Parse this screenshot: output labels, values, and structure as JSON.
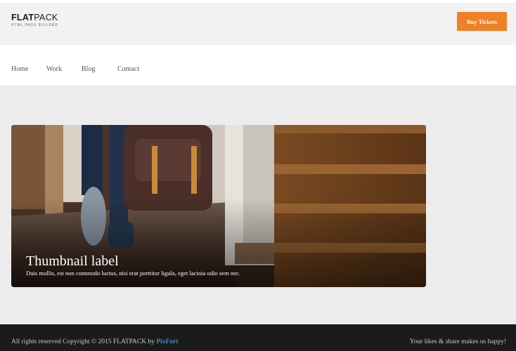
{
  "header": {
    "logo": {
      "title_bold": "FLAT",
      "title_thin": "PACK",
      "subtitle": "HTML PAGE BUILDER"
    },
    "cta_label": "Buy Tickets"
  },
  "nav": {
    "items": [
      {
        "label": "Home"
      },
      {
        "label": "Work"
      },
      {
        "label": "Blog"
      },
      {
        "label": "Contact"
      }
    ]
  },
  "thumbnail": {
    "title": "Thumbnail label",
    "text": "Duis mollis, est non commodo luctus, nisi erat porttitor ligula, eget lacinia odio sem nec."
  },
  "footer": {
    "copyright_text": "All rights reserved Copyright © 2015 FLATPACK by",
    "copyright_link": "PixFort",
    "tagline": "Your likes & share makes us happy!"
  },
  "colors": {
    "accent": "#f08027",
    "header_bg": "#f2f2f2",
    "page_bg": "#ececec",
    "footer_bg": "#1b1b1b",
    "link": "#3d8fd1"
  }
}
